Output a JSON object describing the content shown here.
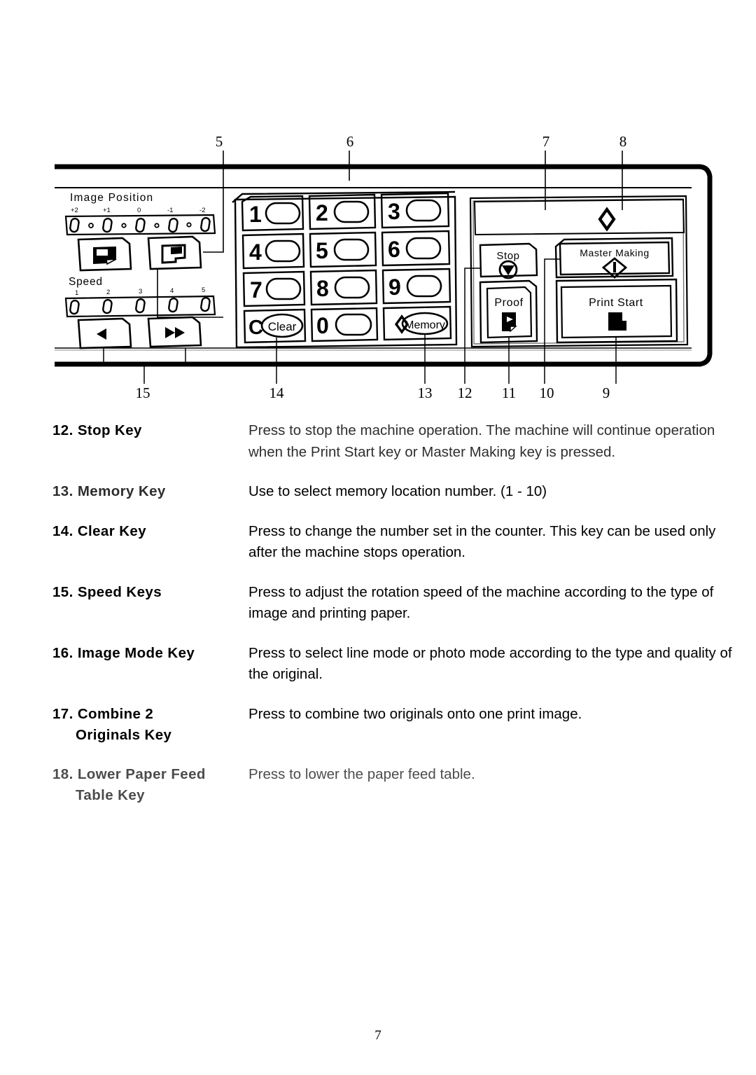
{
  "page": {
    "number": "7"
  },
  "diagram": {
    "title": "operation-panel-diagram",
    "callouts_top": [
      {
        "id": "5",
        "label": "5"
      },
      {
        "id": "6",
        "label": "6"
      },
      {
        "id": "7",
        "label": "7"
      },
      {
        "id": "8",
        "label": "8"
      }
    ],
    "callouts_bottom": [
      {
        "id": "15",
        "label": "15"
      },
      {
        "id": "14",
        "label": "14"
      },
      {
        "id": "13",
        "label": "13"
      },
      {
        "id": "12",
        "label": "12"
      },
      {
        "id": "11",
        "label": "11"
      },
      {
        "id": "10",
        "label": "10"
      },
      {
        "id": "9",
        "label": "9"
      }
    ],
    "image_position": {
      "title": "Image Position",
      "scale": [
        "+2",
        "+1",
        "0",
        "-1",
        "-2"
      ]
    },
    "speed": {
      "title": "Speed",
      "scale": [
        "1",
        "2",
        "3",
        "4",
        "5"
      ]
    },
    "keypad": {
      "keys": [
        "1",
        "2",
        "3",
        "4",
        "5",
        "6",
        "7",
        "8",
        "9"
      ],
      "clear_prefix": "C",
      "clear_label": "Clear",
      "zero_label": "0",
      "memory_label": "Memory"
    },
    "action_keys": {
      "stop": "Stop",
      "master_making": "Master Making",
      "proof": "Proof",
      "print_start": "Print Start"
    }
  },
  "entries": [
    {
      "number": "12.",
      "label": "Stop Key",
      "label_line2": "",
      "description": "Press to stop the machine operation.  The machine will continue operation when the Print Start key or Master Making key is pressed."
    },
    {
      "number": "13.",
      "label": "Memory Key",
      "label_line2": "",
      "description": "Use to select memory location number. (1 - 10)"
    },
    {
      "number": "14.",
      "label": "Clear Key",
      "label_line2": "",
      "description": "Press to change the number set in the counter.  This key can be used only after the machine stops operation."
    },
    {
      "number": "15.",
      "label": "Speed Keys",
      "label_line2": "",
      "description": "Press to adjust the rotation speed of the machine according to the type of image and printing paper."
    },
    {
      "number": "16.",
      "label": "Image Mode Key",
      "label_line2": "",
      "description": "Press to select line mode or photo mode according to the type and quality of the original."
    },
    {
      "number": "17.",
      "label": "Combine 2",
      "label_line2": "Originals Key",
      "description": "Press to combine two originals onto one print image."
    },
    {
      "number": "18.",
      "label": "Lower Paper Feed",
      "label_line2": "Table Key",
      "description": "Press to lower the paper feed table."
    }
  ]
}
